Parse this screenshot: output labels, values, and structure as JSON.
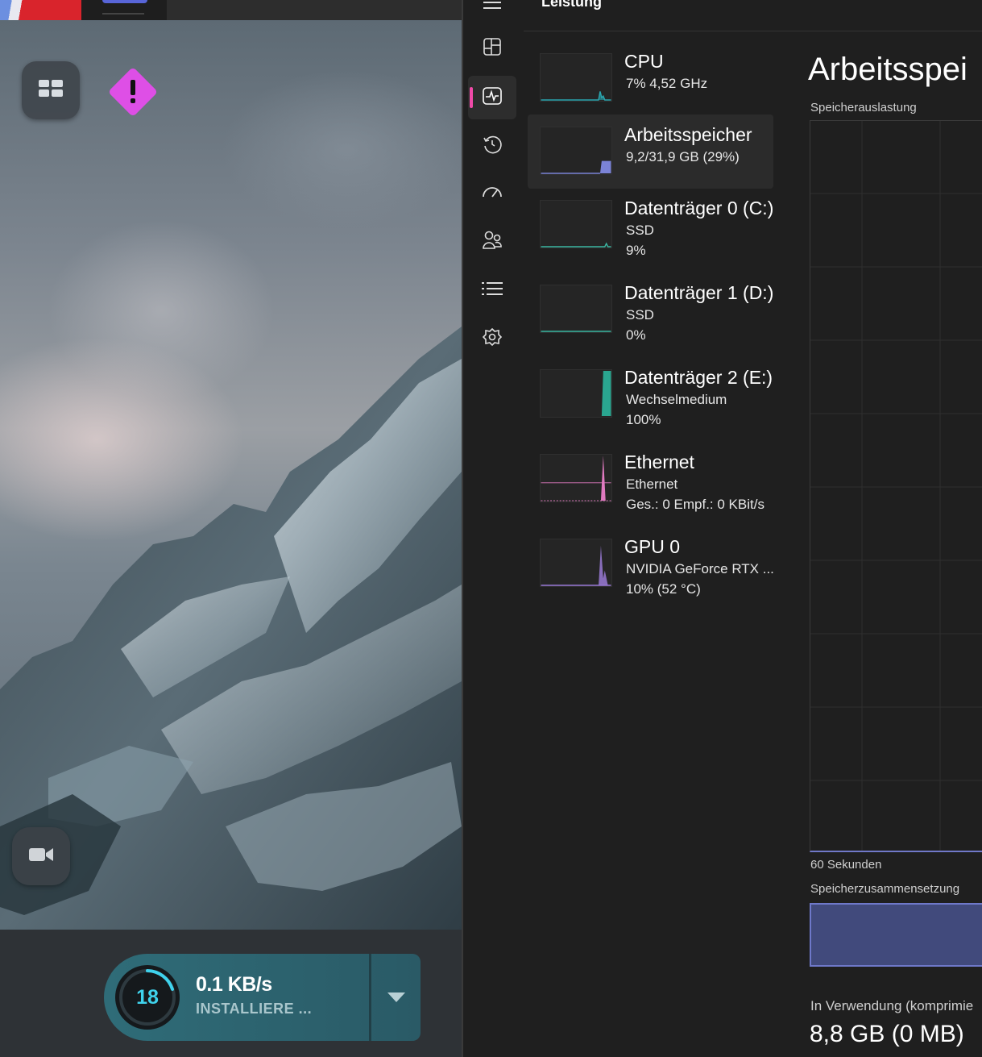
{
  "launcher": {
    "icons": {
      "grid": "grid-icon",
      "warning": "warning-icon",
      "video": "video-camera-icon",
      "menu": "chevron-down-icon"
    },
    "colors": {
      "warning_badge": "#de4fe6",
      "accent": "#3fd2ec",
      "pill": "#2f6c78"
    },
    "download": {
      "count": "18",
      "speed": "0.1 KB/s",
      "status": "INSTALLIERE ..."
    }
  },
  "taskmanager": {
    "title": "Leistung",
    "nav_icons": [
      "hamburger-icon",
      "processes-icon",
      "performance-icon",
      "app-history-icon",
      "startup-icon",
      "users-icon",
      "details-icon",
      "services-icon"
    ],
    "items": [
      {
        "name": "CPU",
        "sub1": "7%  4,52 GHz",
        "sub2": "",
        "color": "#2aa6b0"
      },
      {
        "name": "Arbeitsspeicher",
        "sub1": "9,2/31,9 GB (29%)",
        "sub2": "",
        "color": "#7b83d6"
      },
      {
        "name": "Datenträger 0 (C:)",
        "sub1": "SSD",
        "sub2": "9%",
        "color": "#3ab7a2"
      },
      {
        "name": "Datenträger 1 (D:)",
        "sub1": "SSD",
        "sub2": "0%",
        "color": "#3ab7a2"
      },
      {
        "name": "Datenträger 2 (E:)",
        "sub1": "Wechselmedium",
        "sub2": "100%",
        "color": "#2aa690"
      },
      {
        "name": "Ethernet",
        "sub1": "Ethernet",
        "sub2": "Ges.: 0  Empf.: 0 KBit/s",
        "color": "#e07ac0"
      },
      {
        "name": "GPU 0",
        "sub1": "NVIDIA GeForce RTX ...",
        "sub2": "10%  (52 °C)",
        "color": "#9a7ad6"
      }
    ],
    "detail": {
      "title": "Arbeitsspei",
      "usage_label": "Speicherauslastung",
      "seconds_label": "60 Sekunden",
      "composition_label": "Speicherzusammensetzung",
      "in_use_label": "In Verwendung (komprimie",
      "in_use_value": "8,8 GB (0 MB)"
    }
  }
}
